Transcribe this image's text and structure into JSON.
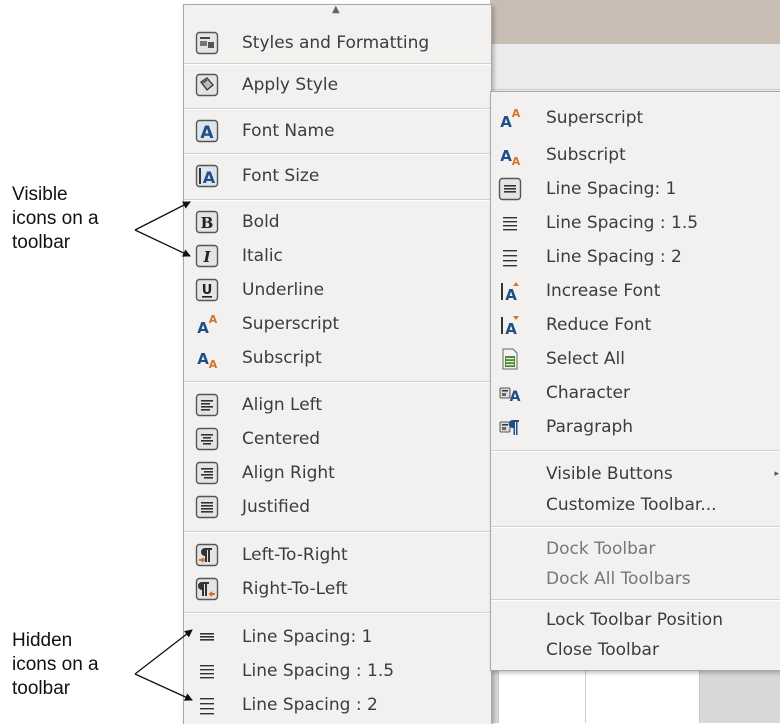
{
  "left_menu": {
    "items": [
      {
        "label": "Styles and Formatting",
        "icon": "styles-formatting-icon"
      },
      {
        "label": "Apply Style",
        "icon": "apply-style-icon"
      },
      {
        "label": "Font Name",
        "icon": "font-name-icon"
      },
      {
        "label": "Font Size",
        "icon": "font-size-icon"
      },
      {
        "label": "Bold",
        "icon": "bold-icon"
      },
      {
        "label": "Italic",
        "icon": "italic-icon"
      },
      {
        "label": "Underline",
        "icon": "underline-icon"
      },
      {
        "label": "Superscript",
        "icon": "superscript-icon"
      },
      {
        "label": "Subscript",
        "icon": "subscript-icon"
      },
      {
        "label": "Align Left",
        "icon": "align-left-icon"
      },
      {
        "label": "Centered",
        "icon": "align-center-icon"
      },
      {
        "label": "Align Right",
        "icon": "align-right-icon"
      },
      {
        "label": "Justified",
        "icon": "justified-icon"
      },
      {
        "label": "Left-To-Right",
        "icon": "left-to-right-icon"
      },
      {
        "label": "Right-To-Left",
        "icon": "right-to-left-icon"
      },
      {
        "label": "Line Spacing: 1",
        "icon": "line-spacing-1-icon"
      },
      {
        "label": "Line Spacing : 1.5",
        "icon": "line-spacing-15-icon"
      },
      {
        "label": "Line Spacing : 2",
        "icon": "line-spacing-2-icon"
      }
    ]
  },
  "right_menu": {
    "items": [
      {
        "label": "Superscript",
        "icon": "superscript-icon"
      },
      {
        "label": "Subscript",
        "icon": "subscript-icon"
      },
      {
        "label": "Line Spacing: 1",
        "icon": "line-spacing-1-icon"
      },
      {
        "label": "Line Spacing : 1.5",
        "icon": "line-spacing-15-icon"
      },
      {
        "label": "Line Spacing : 2",
        "icon": "line-spacing-2-icon"
      },
      {
        "label": "Increase Font",
        "icon": "increase-font-icon"
      },
      {
        "label": "Reduce Font",
        "icon": "reduce-font-icon"
      },
      {
        "label": "Select All",
        "icon": "select-all-icon"
      },
      {
        "label": "Character",
        "icon": "character-icon"
      },
      {
        "label": "Paragraph",
        "icon": "paragraph-icon"
      },
      {
        "label": "Visible Buttons"
      },
      {
        "label": "Customize Toolbar..."
      },
      {
        "label": "Dock Toolbar"
      },
      {
        "label": "Dock All Toolbars"
      },
      {
        "label": "Lock Toolbar Position"
      },
      {
        "label": "Close Toolbar"
      }
    ]
  },
  "annotations": {
    "visible": [
      "Visible",
      "icons on a",
      "toolbar"
    ],
    "hidden": [
      "Hidden",
      "icons on a",
      "toolbar"
    ]
  },
  "colors": {
    "menu_bg": "#f2f1f0",
    "icon_blue": "#1e4f86",
    "icon_orange": "#d9702a",
    "icon_green": "#4e8a2e"
  }
}
